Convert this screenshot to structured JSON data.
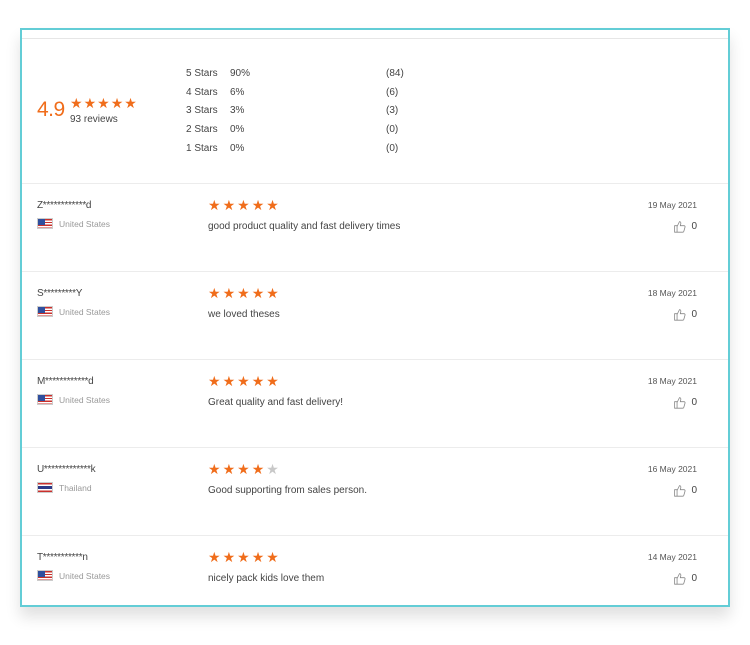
{
  "summary": {
    "average": "4.9",
    "average_stars": 5,
    "review_count_label": "93 reviews",
    "histogram": [
      {
        "label": "5 Stars",
        "percent": "90%",
        "count": "(84)"
      },
      {
        "label": "4 Stars",
        "percent": "6%",
        "count": "(6)"
      },
      {
        "label": "3 Stars",
        "percent": "3%",
        "count": "(3)"
      },
      {
        "label": "2 Stars",
        "percent": "0%",
        "count": "(0)"
      },
      {
        "label": "1 Stars",
        "percent": "0%",
        "count": "(0)"
      }
    ]
  },
  "colors": {
    "accent": "#f06d1b",
    "frame_border": "#63cdd6",
    "star_off": "#c8c8c8"
  },
  "reviews": [
    {
      "name": "Z************d",
      "country": "United States",
      "flag": "us-flag",
      "stars": 5,
      "text": "good product quality and fast delivery times",
      "date": "19 May 2021",
      "likes": "0"
    },
    {
      "name": "S*********Y",
      "country": "United States",
      "flag": "us-flag",
      "stars": 5,
      "text": "we loved theses",
      "date": "18 May 2021",
      "likes": "0"
    },
    {
      "name": "M************d",
      "country": "United States",
      "flag": "us-flag",
      "stars": 5,
      "text": "Great quality and fast delivery!",
      "date": "18 May 2021",
      "likes": "0"
    },
    {
      "name": "U*************k",
      "country": "Thailand",
      "flag": "th-flag",
      "stars": 4,
      "text": "Good supporting from sales person.",
      "date": "16 May 2021",
      "likes": "0"
    },
    {
      "name": "T***********n",
      "country": "United States",
      "flag": "us-flag",
      "stars": 5,
      "text": "nicely pack kids love them",
      "date": "14 May 2021",
      "likes": "0"
    }
  ]
}
